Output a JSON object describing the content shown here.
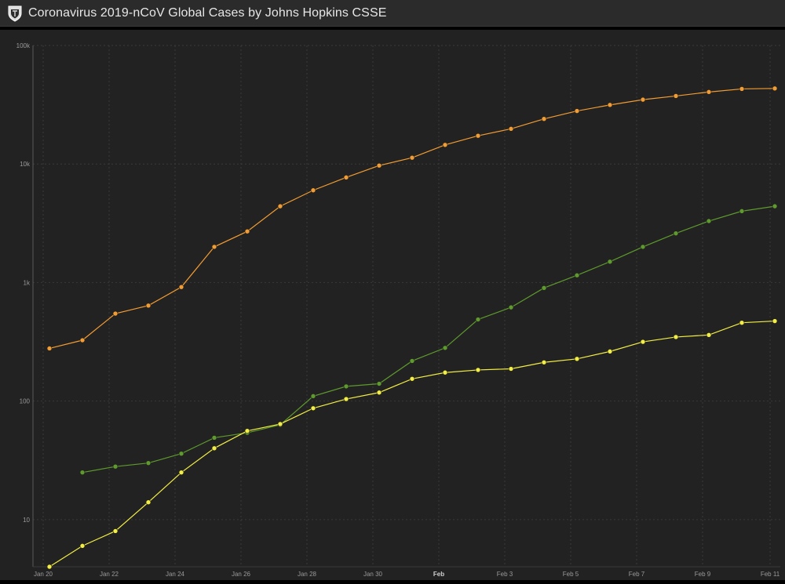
{
  "header": {
    "title": "Coronavirus 2019-nCoV Global Cases by Johns Hopkins CSSE",
    "logo_icon": "jhu-shield-icon"
  },
  "colors": {
    "background": "#222222",
    "header_background": "#2b2b2b",
    "gridline": "#3a3a3a",
    "axis_text": "#9a9a9a",
    "confirmed": "#f29c32",
    "recovered": "#5e9a2c",
    "deaths": "#f2ee44"
  },
  "chart_data": {
    "type": "line",
    "title": "",
    "xlabel": "",
    "ylabel": "",
    "y_scale": "log",
    "ylim": [
      4,
      100000
    ],
    "grid": true,
    "y_ticks": [
      {
        "value": 10,
        "label": "10"
      },
      {
        "value": 100,
        "label": "100"
      },
      {
        "value": 1000,
        "label": "1k"
      },
      {
        "value": 10000,
        "label": "10k"
      },
      {
        "value": 100000,
        "label": "100k"
      }
    ],
    "x_ticks": [
      "Jan 20",
      "Jan 22",
      "Jan 24",
      "Jan 26",
      "Jan 28",
      "Jan 30",
      "Feb",
      "Feb 3",
      "Feb 5",
      "Feb 7",
      "Feb 9",
      "Feb 11"
    ],
    "x_tick_bold": [
      false,
      false,
      false,
      false,
      false,
      false,
      true,
      false,
      false,
      false,
      false,
      false
    ],
    "x": [
      "Jan 20",
      "Jan 21",
      "Jan 22",
      "Jan 23",
      "Jan 24",
      "Jan 25",
      "Jan 26",
      "Jan 27",
      "Jan 28",
      "Jan 29",
      "Jan 30",
      "Jan 31",
      "Feb 1",
      "Feb 2",
      "Feb 3",
      "Feb 4",
      "Feb 5",
      "Feb 6",
      "Feb 7",
      "Feb 8",
      "Feb 9",
      "Feb 10",
      "Feb 11"
    ],
    "series": [
      {
        "color": "#f29c32",
        "values": [
          278,
          326,
          547,
          639,
          916,
          2000,
          2700,
          4400,
          6000,
          7700,
          9700,
          11300,
          14500,
          17300,
          19800,
          24000,
          28000,
          31500,
          34900,
          37500,
          40500,
          43000,
          43400
        ]
      },
      {
        "color": "#5e9a2c",
        "values": [
          null,
          25,
          28,
          30,
          36,
          49,
          54,
          63,
          110,
          133,
          140,
          218,
          281,
          488,
          617,
          900,
          1150,
          1500,
          2000,
          2600,
          3300,
          4000,
          4400
        ]
      },
      {
        "color": "#f2ee44",
        "values": [
          4,
          6,
          8,
          14,
          25,
          40,
          56,
          64,
          87,
          104,
          118,
          154,
          174,
          183,
          187,
          212,
          227,
          262,
          316,
          347,
          361,
          458,
          473
        ]
      }
    ]
  }
}
